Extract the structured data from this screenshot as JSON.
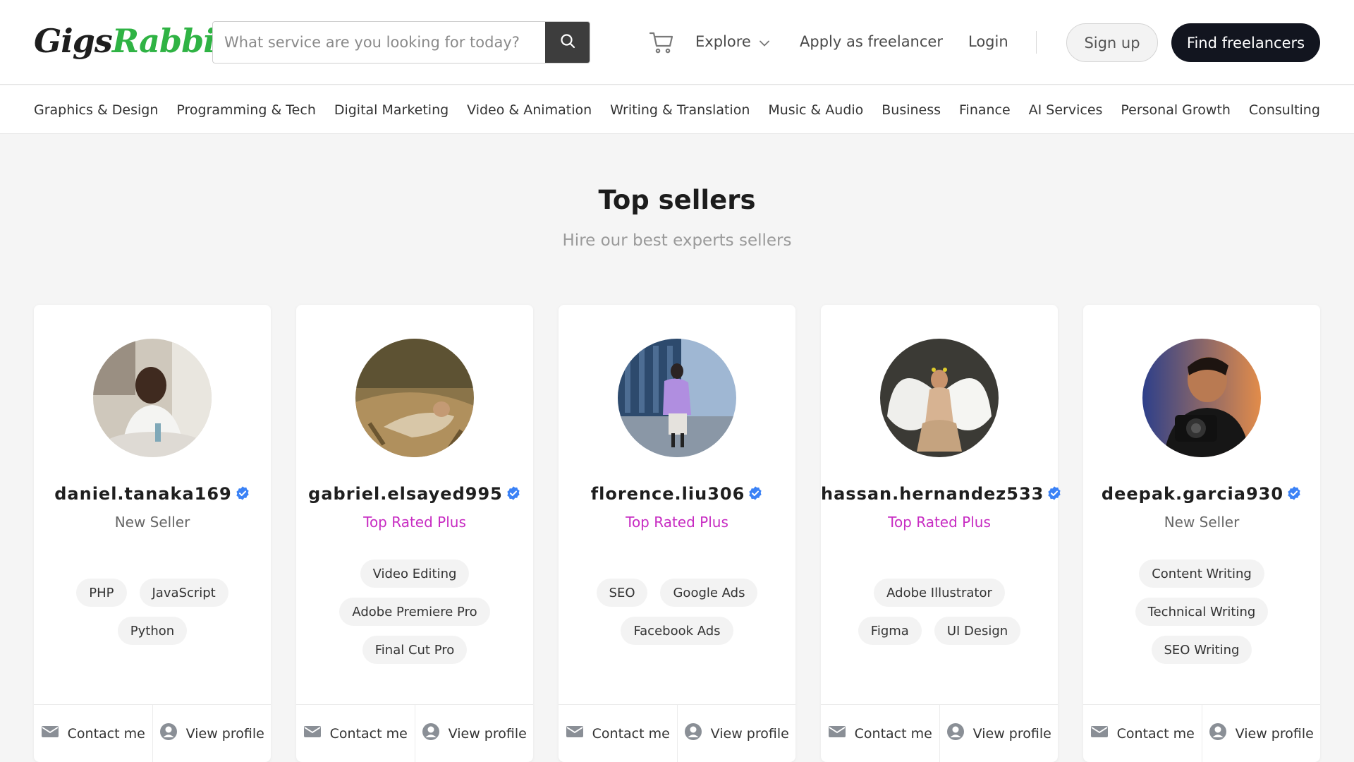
{
  "header": {
    "logo_part1": "Gigs",
    "logo_part2": "Rabbit",
    "search_placeholder": "What service are you looking for today?",
    "explore_label": "Explore",
    "apply_label": "Apply as freelancer",
    "login_label": "Login",
    "signup_label": "Sign up",
    "find_label": "Find freelancers"
  },
  "categories": [
    "Graphics & Design",
    "Programming & Tech",
    "Digital Marketing",
    "Video & Animation",
    "Writing & Translation",
    "Music & Audio",
    "Business",
    "Finance",
    "AI Services",
    "Personal Growth",
    "Consulting"
  ],
  "section": {
    "title": "Top sellers",
    "subtitle": "Hire our best experts sellers"
  },
  "sellers": [
    {
      "username": "daniel.tanaka169",
      "level": "New Seller",
      "skill_rows": [
        [
          "PHP",
          "JavaScript"
        ],
        [
          "Python"
        ]
      ],
      "contact_label": "Contact me",
      "view_label": "View profile"
    },
    {
      "username": "gabriel.elsayed995",
      "level": "Top Rated Plus",
      "skill_rows": [
        [
          "Video Editing"
        ],
        [
          "Adobe Premiere Pro"
        ],
        [
          "Final Cut Pro"
        ]
      ],
      "contact_label": "Contact me",
      "view_label": "View profile"
    },
    {
      "username": "florence.liu306",
      "level": "Top Rated Plus",
      "skill_rows": [
        [
          "SEO",
          "Google Ads"
        ],
        [
          "Facebook Ads"
        ]
      ],
      "contact_label": "Contact me",
      "view_label": "View profile"
    },
    {
      "username": "hassan.hernandez533",
      "level": "Top Rated Plus",
      "skill_rows": [
        [
          "Adobe Illustrator"
        ],
        [
          "Figma",
          "UI Design"
        ]
      ],
      "contact_label": "Contact me",
      "view_label": "View profile"
    },
    {
      "username": "deepak.garcia930",
      "level": "New Seller",
      "skill_rows": [
        [
          "Content Writing"
        ],
        [
          "Technical Writing"
        ],
        [
          "SEO Writing"
        ]
      ],
      "contact_label": "Contact me",
      "view_label": "View profile"
    }
  ],
  "colors": {
    "brand_green": "#2fb344",
    "top_rated": "#c72bc2",
    "verified_blue": "#3b82f6",
    "dark_button": "#12151f"
  },
  "icons": [
    "search-icon",
    "cart-icon",
    "chevron-down-icon",
    "verified-badge-icon",
    "envelope-icon",
    "user-circle-icon"
  ]
}
